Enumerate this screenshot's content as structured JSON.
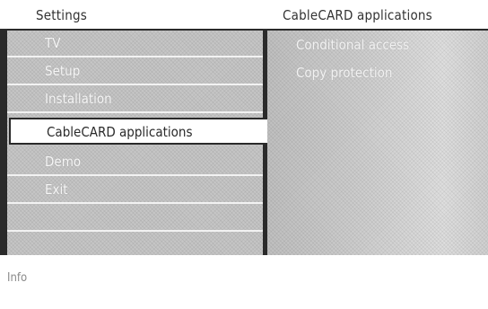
{
  "header": {
    "menu_title": "Settings",
    "submenu_title": "CableCARD applications"
  },
  "menu": {
    "items": [
      {
        "label": "TV"
      },
      {
        "label": "Setup"
      },
      {
        "label": "Installation"
      },
      {
        "label": "CableCARD applications",
        "selected": true
      },
      {
        "label": "Demo"
      },
      {
        "label": "Exit"
      },
      {
        "label": ""
      },
      {
        "label": ""
      }
    ]
  },
  "submenu": {
    "items": [
      {
        "label": "Conditional access"
      },
      {
        "label": "Copy protection"
      }
    ]
  },
  "info": {
    "label": "Info"
  },
  "colors": {
    "panel_dark": "#2a2a2a",
    "menu_grey": "#c6c6c6",
    "highlight": "#ffffff"
  }
}
